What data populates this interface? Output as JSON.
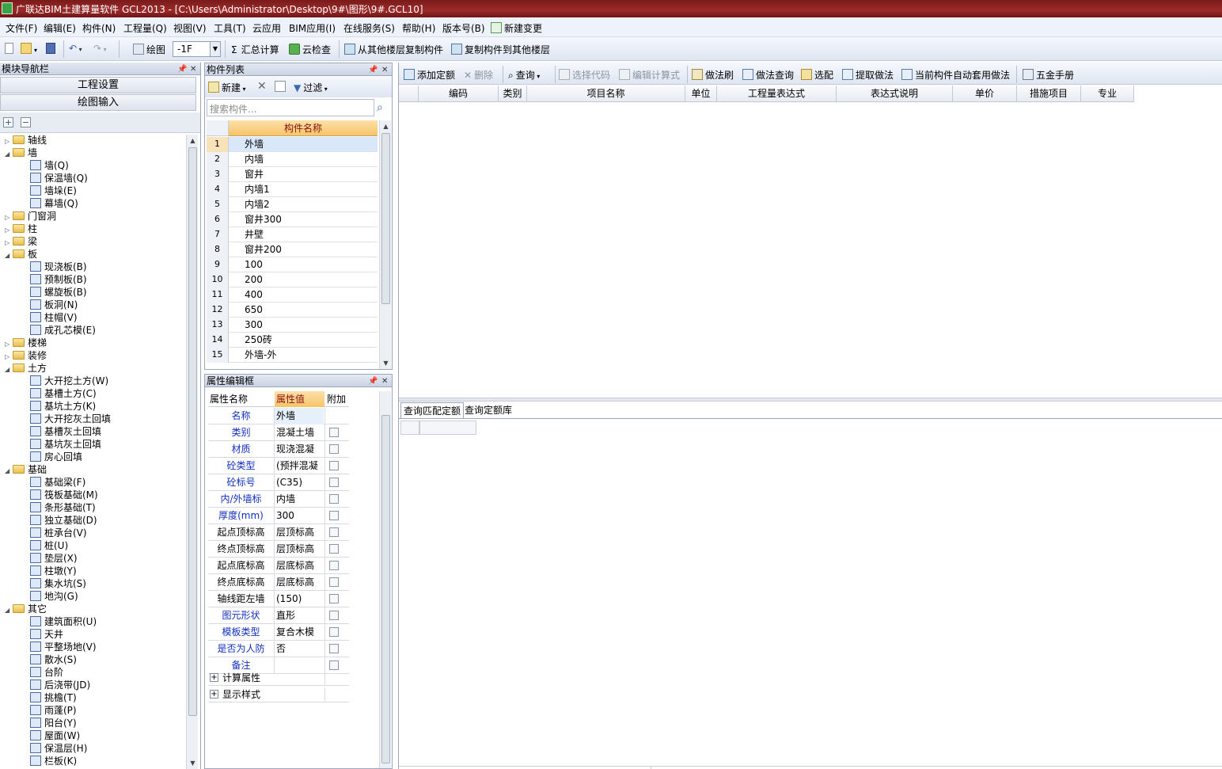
{
  "window": {
    "title": "广联达BIM土建算量软件 GCL2013 - [C:\\Users\\Administrator\\Desktop\\9#\\图形\\9#.GCL10]"
  },
  "menu": [
    "文件(F)",
    "编辑(E)",
    "构件(N)",
    "工程量(Q)",
    "视图(V)",
    "工具(T)",
    "云应用",
    "BIM应用(I)",
    "在线服务(S)",
    "帮助(H)",
    "版本号(B)",
    "新建变更"
  ],
  "toolbar": {
    "draw_label": "绘图",
    "floor_value": "-1F",
    "sum_label": "汇总计算",
    "cloud_check_label": "云检查",
    "copy_from_floor_label": "从其他楼层复制构件",
    "copy_to_floor_label": "复制构件到其他楼层"
  },
  "nav": {
    "title": "模块导航栏",
    "btn_project": "工程设置",
    "btn_draw": "绘图输入",
    "tree": [
      {
        "label": "轴线",
        "level": 0,
        "type": "folder",
        "expanded": false
      },
      {
        "label": "墙",
        "level": 0,
        "type": "folder",
        "expanded": true
      },
      {
        "label": "墙(Q)",
        "level": 1,
        "type": "leaf"
      },
      {
        "label": "保温墙(Q)",
        "level": 1,
        "type": "leaf"
      },
      {
        "label": "墙垛(E)",
        "level": 1,
        "type": "leaf"
      },
      {
        "label": "幕墙(Q)",
        "level": 1,
        "type": "leaf"
      },
      {
        "label": "门窗洞",
        "level": 0,
        "type": "folder",
        "expanded": false
      },
      {
        "label": "柱",
        "level": 0,
        "type": "folder",
        "expanded": false
      },
      {
        "label": "梁",
        "level": 0,
        "type": "folder",
        "expanded": false
      },
      {
        "label": "板",
        "level": 0,
        "type": "folder",
        "expanded": true
      },
      {
        "label": "现浇板(B)",
        "level": 1,
        "type": "leaf"
      },
      {
        "label": "预制板(B)",
        "level": 1,
        "type": "leaf"
      },
      {
        "label": "螺旋板(B)",
        "level": 1,
        "type": "leaf"
      },
      {
        "label": "板洞(N)",
        "level": 1,
        "type": "leaf"
      },
      {
        "label": "柱帽(V)",
        "level": 1,
        "type": "leaf"
      },
      {
        "label": "成孔芯模(E)",
        "level": 1,
        "type": "leaf"
      },
      {
        "label": "楼梯",
        "level": 0,
        "type": "folder",
        "expanded": false
      },
      {
        "label": "装修",
        "level": 0,
        "type": "folder",
        "expanded": false
      },
      {
        "label": "土方",
        "level": 0,
        "type": "folder",
        "expanded": true
      },
      {
        "label": "大开挖土方(W)",
        "level": 1,
        "type": "leaf"
      },
      {
        "label": "基槽土方(C)",
        "level": 1,
        "type": "leaf"
      },
      {
        "label": "基坑土方(K)",
        "level": 1,
        "type": "leaf"
      },
      {
        "label": "大开挖灰土回填",
        "level": 1,
        "type": "leaf"
      },
      {
        "label": "基槽灰土回填",
        "level": 1,
        "type": "leaf"
      },
      {
        "label": "基坑灰土回填",
        "level": 1,
        "type": "leaf"
      },
      {
        "label": "房心回填",
        "level": 1,
        "type": "leaf"
      },
      {
        "label": "基础",
        "level": 0,
        "type": "folder",
        "expanded": true
      },
      {
        "label": "基础梁(F)",
        "level": 1,
        "type": "leaf"
      },
      {
        "label": "筏板基础(M)",
        "level": 1,
        "type": "leaf"
      },
      {
        "label": "条形基础(T)",
        "level": 1,
        "type": "leaf"
      },
      {
        "label": "独立基础(D)",
        "level": 1,
        "type": "leaf"
      },
      {
        "label": "桩承台(V)",
        "level": 1,
        "type": "leaf"
      },
      {
        "label": "桩(U)",
        "level": 1,
        "type": "leaf"
      },
      {
        "label": "垫层(X)",
        "level": 1,
        "type": "leaf"
      },
      {
        "label": "柱墩(Y)",
        "level": 1,
        "type": "leaf"
      },
      {
        "label": "集水坑(S)",
        "level": 1,
        "type": "leaf"
      },
      {
        "label": "地沟(G)",
        "level": 1,
        "type": "leaf"
      },
      {
        "label": "其它",
        "level": 0,
        "type": "folder",
        "expanded": true
      },
      {
        "label": "建筑面积(U)",
        "level": 1,
        "type": "leaf"
      },
      {
        "label": "天井",
        "level": 1,
        "type": "leaf"
      },
      {
        "label": "平整场地(V)",
        "level": 1,
        "type": "leaf"
      },
      {
        "label": "散水(S)",
        "level": 1,
        "type": "leaf"
      },
      {
        "label": "台阶",
        "level": 1,
        "type": "leaf"
      },
      {
        "label": "后浇带(JD)",
        "level": 1,
        "type": "leaf"
      },
      {
        "label": "挑檐(T)",
        "level": 1,
        "type": "leaf"
      },
      {
        "label": "雨蓬(P)",
        "level": 1,
        "type": "leaf"
      },
      {
        "label": "阳台(Y)",
        "level": 1,
        "type": "leaf"
      },
      {
        "label": "屋面(W)",
        "level": 1,
        "type": "leaf"
      },
      {
        "label": "保温层(H)",
        "level": 1,
        "type": "leaf"
      },
      {
        "label": "栏板(K)",
        "level": 1,
        "type": "leaf"
      }
    ]
  },
  "complist": {
    "title": "构件列表",
    "new_label": "新建",
    "filter_label": "过滤",
    "search_placeholder": "搜索构件...",
    "col_header": "构件名称",
    "rows": [
      {
        "num": "1",
        "name": "外墙"
      },
      {
        "num": "2",
        "name": "内墙"
      },
      {
        "num": "3",
        "name": "窗井"
      },
      {
        "num": "4",
        "name": "内墙1"
      },
      {
        "num": "5",
        "name": "内墙2"
      },
      {
        "num": "6",
        "name": "窗井300"
      },
      {
        "num": "7",
        "name": "井壁"
      },
      {
        "num": "8",
        "name": "窗井200"
      },
      {
        "num": "9",
        "name": "100"
      },
      {
        "num": "10",
        "name": "200"
      },
      {
        "num": "11",
        "name": "400"
      },
      {
        "num": "12",
        "name": "650"
      },
      {
        "num": "13",
        "name": "300"
      },
      {
        "num": "14",
        "name": "250砖"
      },
      {
        "num": "15",
        "name": "外墙-外"
      }
    ]
  },
  "propedit": {
    "title": "属性编辑框",
    "headers": [
      "属性名称",
      "属性值",
      "附加"
    ],
    "rows": [
      {
        "name": "名称",
        "value": "外墙",
        "blue": true,
        "check": false
      },
      {
        "name": "类别",
        "value": "混凝土墙",
        "blue": true,
        "check": true
      },
      {
        "name": "材质",
        "value": "现浇混凝",
        "blue": true,
        "check": true
      },
      {
        "name": "砼类型",
        "value": "(预拌混凝",
        "blue": true,
        "check": true
      },
      {
        "name": "砼标号",
        "value": "(C35)",
        "blue": true,
        "check": true
      },
      {
        "name": "内/外墙标",
        "value": "内墙",
        "blue": true,
        "check": true
      },
      {
        "name": "厚度(mm)",
        "value": "300",
        "blue": true,
        "check": true
      },
      {
        "name": "起点顶标高",
        "value": "层顶标高",
        "blue": false,
        "check": true
      },
      {
        "name": "终点顶标高",
        "value": "层顶标高",
        "blue": false,
        "check": true
      },
      {
        "name": "起点底标高",
        "value": "层底标高",
        "blue": false,
        "check": true
      },
      {
        "name": "终点底标高",
        "value": "层底标高",
        "blue": false,
        "check": true
      },
      {
        "name": "轴线距左墙",
        "value": "(150)",
        "blue": false,
        "check": true
      },
      {
        "name": "图元形状",
        "value": "直形",
        "blue": true,
        "check": true
      },
      {
        "name": "模板类型",
        "value": "复合木模",
        "blue": true,
        "check": true
      },
      {
        "name": "是否为人防",
        "value": "否",
        "blue": true,
        "check": true
      },
      {
        "name": "备注",
        "value": "",
        "blue": true,
        "check": true
      }
    ],
    "groups": [
      "计算属性",
      "显示样式"
    ]
  },
  "right": {
    "toolbar": [
      "添加定额",
      "删除",
      "查询",
      "选择代码",
      "编辑计算式",
      "做法刷",
      "做法查询",
      "选配",
      "提取做法",
      "当前构件自动套用做法",
      "五金手册"
    ],
    "columns": [
      "编码",
      "类别",
      "项目名称",
      "单位",
      "工程量表达式",
      "表达式说明",
      "单价",
      "措施项目",
      "专业"
    ],
    "tabs": [
      "查询匹配定额",
      "查询定额库"
    ]
  }
}
